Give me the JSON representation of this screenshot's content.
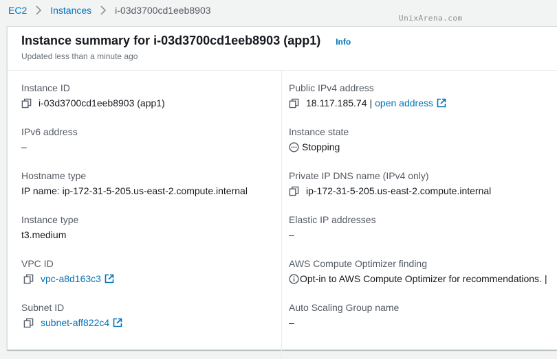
{
  "breadcrumb": {
    "items": [
      "EC2",
      "Instances",
      "i-03d3700cd1eeb8903"
    ]
  },
  "watermark": "UnixArena.com",
  "summary": {
    "title": "Instance summary for i-03d3700cd1eeb8903 (app1)",
    "info_label": "Info",
    "subtitle": "Updated less than a minute ago"
  },
  "left_fields": {
    "instance_id": {
      "label": "Instance ID",
      "value": "i-03d3700cd1eeb8903 (app1)"
    },
    "ipv6": {
      "label": "IPv6 address",
      "value": "–"
    },
    "hostname_type": {
      "label": "Hostname type",
      "value": "IP name: ip-172-31-5-205.us-east-2.compute.internal"
    },
    "instance_type": {
      "label": "Instance type",
      "value": "t3.medium"
    },
    "vpc_id": {
      "label": "VPC ID",
      "value": "vpc-a8d163c3"
    },
    "subnet_id": {
      "label": "Subnet ID",
      "value": "subnet-aff822c4"
    }
  },
  "right_fields": {
    "public_ipv4": {
      "label": "Public IPv4 address",
      "value": "18.117.185.74",
      "separator": "|",
      "link": "open address"
    },
    "instance_state": {
      "label": "Instance state",
      "value": "Stopping"
    },
    "private_dns": {
      "label": "Private IP DNS name (IPv4 only)",
      "value": "ip-172-31-5-205.us-east-2.compute.internal"
    },
    "elastic_ip": {
      "label": "Elastic IP addresses",
      "value": "–"
    },
    "optimizer": {
      "label": "AWS Compute Optimizer finding",
      "value": "Opt-in to AWS Compute Optimizer for recommendations.",
      "separator": "|"
    },
    "asg": {
      "label": "Auto Scaling Group name",
      "value": "–"
    }
  },
  "icons": {
    "copy": "copy-icon",
    "external": "external-link-icon",
    "status": "stopping-status-icon",
    "info": "info-circle-icon",
    "chevron": "chevron-right-icon"
  },
  "colors": {
    "link": "#0073bb",
    "text": "#16191f",
    "label": "#545b64",
    "background": "#f2f3f3"
  }
}
